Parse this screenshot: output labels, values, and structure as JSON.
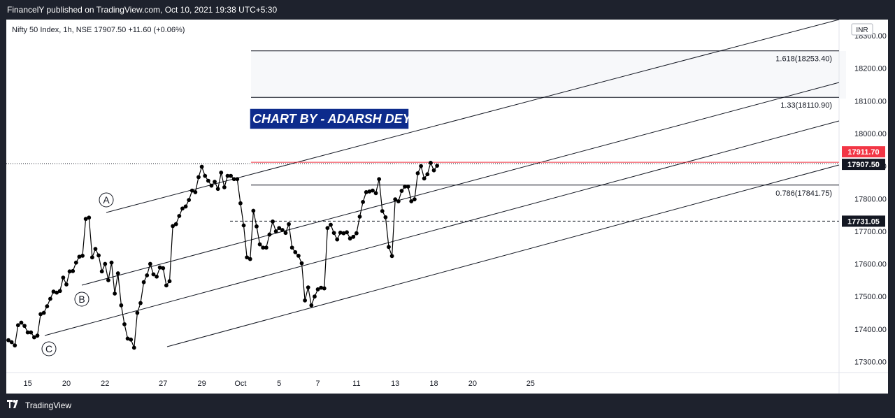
{
  "header": {
    "published_text": "FinancelY published on TradingView.com, Oct 10, 2021 19:38 UTC+5:30"
  },
  "footer": {
    "brand": "TradingView",
    "logo_icon": "tradingview-logo-icon"
  },
  "chart_data": {
    "type": "line",
    "title": "Nifty 50 Index, 1h, NSE  17907.50  +11.60 (+0.06%)",
    "currency": "INR",
    "watermark": "CHART BY - ADARSH DEY",
    "ylim": [
      17260,
      18370
    ],
    "y_ticks": [
      {
        "v": 17300,
        "label": "17300.00"
      },
      {
        "v": 17400,
        "label": "17400.00"
      },
      {
        "v": 17500,
        "label": "17500.00"
      },
      {
        "v": 17600,
        "label": "17600.00"
      },
      {
        "v": 17700,
        "label": "17700.00"
      },
      {
        "v": 17800,
        "label": "17800.00"
      },
      {
        "v": 17900,
        "label": "17900.00"
      },
      {
        "v": 18000,
        "label": "18000.00"
      },
      {
        "v": 18100,
        "label": "18100.00"
      },
      {
        "v": 18200,
        "label": "18200.00"
      },
      {
        "v": 18300,
        "label": "18300.00"
      }
    ],
    "x_ticks": [
      {
        "i": 6,
        "label": "15"
      },
      {
        "i": 18,
        "label": "20"
      },
      {
        "i": 30,
        "label": "22"
      },
      {
        "i": 48,
        "label": "27"
      },
      {
        "i": 60,
        "label": "29"
      },
      {
        "i": 72,
        "label": "Oct"
      },
      {
        "i": 84,
        "label": "5"
      },
      {
        "i": 96,
        "label": "7"
      },
      {
        "i": 108,
        "label": "11"
      },
      {
        "i": 120,
        "label": "13"
      },
      {
        "i": 132,
        "label": "18"
      },
      {
        "i": 144,
        "label": "20"
      },
      {
        "i": 162,
        "label": "25"
      }
    ],
    "series": [
      {
        "values": [
          17366,
          17360,
          17350,
          17412,
          17420,
          17410,
          17390,
          17390,
          17375,
          17380,
          17446,
          17450,
          17470,
          17493,
          17515,
          17512,
          17517,
          17558,
          17537,
          17577,
          17578,
          17604,
          17622,
          17625,
          17738,
          17742,
          17620,
          17646,
          17626,
          17577,
          17600,
          17550,
          17604,
          17509,
          17571,
          17473,
          17415,
          17371,
          17368,
          17343,
          17450,
          17480,
          17544,
          17565,
          17600,
          17568,
          17561,
          17589,
          17587,
          17534,
          17547,
          17716,
          17722,
          17747,
          17770,
          17776,
          17796,
          17825,
          17820,
          17866,
          17898,
          17870,
          17855,
          17840,
          17852,
          17830,
          17880,
          17835,
          17870,
          17870,
          17860,
          17860,
          17786,
          17718,
          17620,
          17615,
          17763,
          17715,
          17660,
          17650,
          17650,
          17690,
          17730,
          17700,
          17710,
          17704,
          17695,
          17722,
          17650,
          17636,
          17625,
          17602,
          17488,
          17528,
          17473,
          17500,
          17522,
          17527,
          17525,
          17710,
          17720,
          17695,
          17675,
          17696,
          17694,
          17697,
          17678,
          17683,
          17694,
          17745,
          17790,
          17820,
          17822,
          17825,
          17817,
          17860,
          17762,
          17743,
          17652,
          17624,
          17798,
          17792,
          17824,
          17837,
          17837,
          17792,
          17798,
          17878,
          17900,
          17862,
          17875,
          17910,
          17887,
          17901
        ]
      }
    ],
    "annotations": [
      {
        "label": "A",
        "kind": "wave-marker"
      },
      {
        "label": "B",
        "kind": "wave-marker"
      },
      {
        "label": "C",
        "kind": "wave-marker"
      },
      {
        "label": "1.618(18253.40)",
        "kind": "fib-level",
        "value": 18253.4
      },
      {
        "label": "1.33(18110.90)",
        "kind": "fib-level",
        "value": 18110.9
      },
      {
        "label": "0.786(17841.75)",
        "kind": "fib-level",
        "value": 17841.75
      }
    ],
    "price_tags": [
      {
        "label": "17911.70",
        "value": 17911.7,
        "color": "#f23645"
      },
      {
        "label": "17907.50",
        "value": 17907.5,
        "color": "#131722"
      },
      {
        "label": "17731.05",
        "value": 17731.05,
        "color": "#131722"
      }
    ],
    "colors": {
      "line": "#000000",
      "watermark_bg": "#0d2b8c",
      "watermark_text": "#ffffff",
      "grid": "#f0f3fa"
    }
  }
}
